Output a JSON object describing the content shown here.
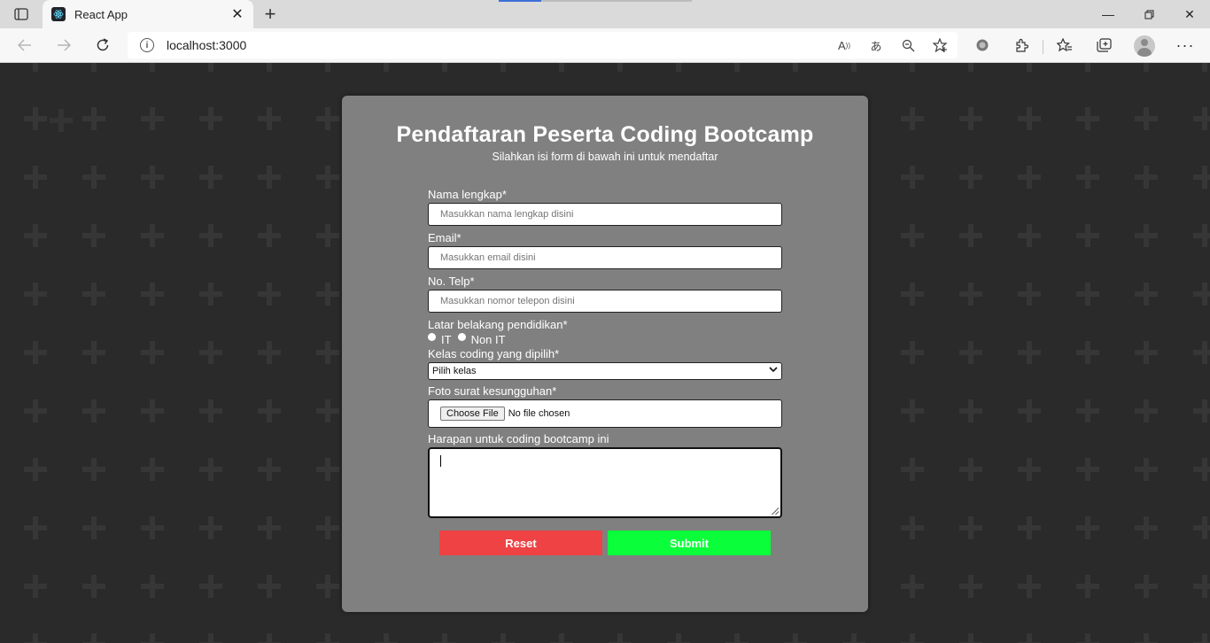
{
  "browser": {
    "tab_title": "React App",
    "url": "localhost:3000"
  },
  "form": {
    "title": "Pendaftaran Peserta Coding Bootcamp",
    "subtitle": "Silahkan isi form di bawah ini untuk mendaftar",
    "name_label": "Nama lengkap*",
    "name_placeholder": "Masukkan nama lengkap disini",
    "email_label": "Email*",
    "email_placeholder": "Masukkan email disini",
    "phone_label": "No. Telp*",
    "phone_placeholder": "Masukkan nomor telepon disini",
    "education_label": "Latar belakang pendidikan*",
    "education_options": [
      "IT",
      "Non IT"
    ],
    "class_label": "Kelas coding yang dipilih*",
    "class_selected": "Pilih kelas",
    "photo_label": "Foto surat kesungguhan*",
    "file_button": "Choose File",
    "file_status": "No file chosen",
    "hope_label": "Harapan untuk coding bootcamp ini",
    "reset_label": "Reset",
    "submit_label": "Submit"
  },
  "colors": {
    "card_bg": "#808080",
    "page_bg": "#2a2a2a",
    "reset": "#ee4244",
    "submit": "#0aff3a"
  }
}
